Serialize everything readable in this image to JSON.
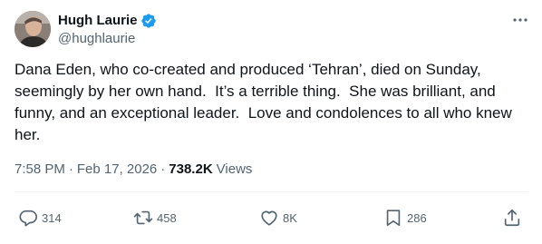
{
  "author": {
    "display_name": "Hugh Laurie",
    "handle": "@hughlaurie",
    "verified": true
  },
  "tweet": {
    "text": "Dana Eden, who co-created and produced ‘Tehran’, died on Sunday, seemingly by her own hand.  It’s a terrible thing.  She was brilliant, and funny, and an exceptional leader.  Love and condolences to all who knew her.",
    "time": "7:58 PM",
    "separator": "·",
    "date": "Feb 17, 2026",
    "views_count": "738.2K",
    "views_label": "Views"
  },
  "actions": {
    "reply_count": "314",
    "repost_count": "458",
    "like_count": "8K",
    "bookmark_count": "286"
  },
  "icons": {
    "more": "more-horizontal-icon",
    "verified": "verified-badge-icon",
    "reply": "reply-icon",
    "repost": "repost-icon",
    "like": "heart-icon",
    "bookmark": "bookmark-icon",
    "share": "share-icon"
  },
  "colors": {
    "text_primary": "#0f1419",
    "text_secondary": "#536471",
    "verified_blue": "#1d9bf0",
    "divider": "#eff3f4"
  }
}
